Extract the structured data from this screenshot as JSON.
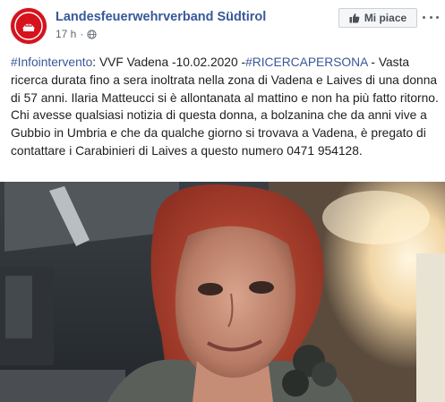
{
  "page": {
    "name": "Landesfeuerwehrverband Südtirol",
    "time": "17 h",
    "separator": "·"
  },
  "like_button": {
    "label": "Mi piace"
  },
  "post": {
    "hashtag_1": "#Infointervento",
    "text_1": ": VVF Vadena -10.02.2020 -",
    "hashtag_2": "#RICERCAPERSONA",
    "text_2": " - Vasta ricerca durata fino a sera inoltrata nella zona di Vadena e Laives di una donna di 57 anni. Ilaria Matteucci si è allontanata al mattino e non ha più fatto ritorno. Chi avesse qualsiasi notizia di questa donna, a bolzanina che da anni vive a Gubbio in Umbria e che da qualche giorno si trovava a Vadena, è pregato di contattare i Carabinieri di Laives a questo numero 0471 954128."
  },
  "icons": {
    "avatar": "fire-brigade-logo",
    "privacy": "globe-icon",
    "like": "thumbs-up-icon",
    "more": "more-options-icon"
  },
  "colors": {
    "link": "#385898",
    "text": "#1c1e21",
    "meta": "#616770",
    "logo_red": "#d6131d"
  }
}
